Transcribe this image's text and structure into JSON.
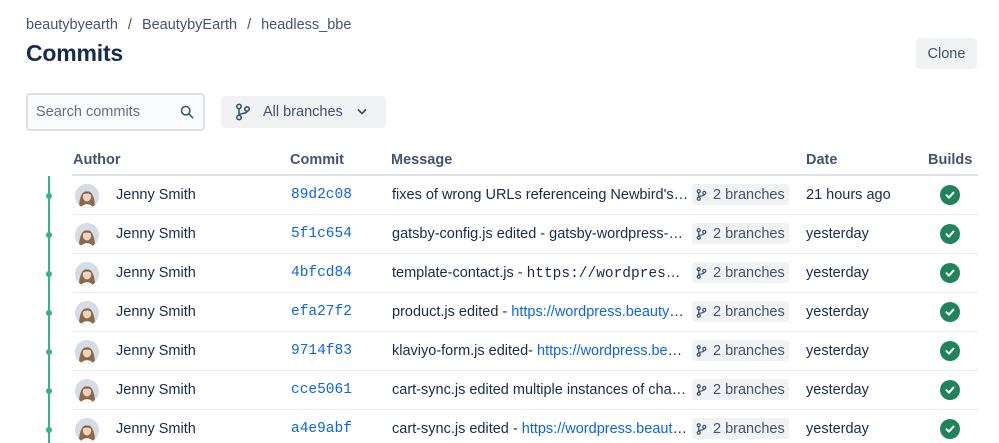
{
  "breadcrumb": {
    "workspace": "beautybyearth",
    "project": "BeautybyEarth",
    "repo": "headless_bbe",
    "separator": "/"
  },
  "page": {
    "title": "Commits",
    "clone_label": "Clone"
  },
  "search": {
    "placeholder": "Search commits",
    "value": ""
  },
  "branch_filter": {
    "label": "All branches"
  },
  "table": {
    "headers": {
      "author": "Author",
      "commit": "Commit",
      "message": "Message",
      "date": "Date",
      "builds": "Builds"
    },
    "rows": [
      {
        "author": "Jenny Smith",
        "hash": "89d2c08",
        "msg_text": "fixes of wrong URLs referenceing Newbird's domain",
        "msg_link": "",
        "msg_code": "",
        "branches": "2 branches",
        "date": "21 hours ago",
        "build_status": "success"
      },
      {
        "author": "Jenny Smith",
        "hash": "5f1c654",
        "msg_text": "gatsby-config.js edited - gatsby-wordpress-source",
        "msg_link": "",
        "msg_code": "",
        "branches": "2 branches",
        "date": "yesterday",
        "build_status": "success"
      },
      {
        "author": "Jenny Smith",
        "hash": "4bfcd84",
        "msg_text": "template-contact.js - ",
        "msg_link": "",
        "msg_code": "https://wordpress.beautybyearth.com",
        "branches": "2 branches",
        "date": "yesterday",
        "build_status": "success"
      },
      {
        "author": "Jenny Smith",
        "hash": "efa27f2",
        "msg_text": "product.js edited - ",
        "msg_link": "https://wordpress.beautybyearth.com",
        "msg_code": "",
        "branches": "2 branches",
        "date": "yesterday",
        "build_status": "success"
      },
      {
        "author": "Jenny Smith",
        "hash": "9714f83",
        "msg_text": "klaviyo-form.js edited- ",
        "msg_link": "https://wordpress.beautybyearth.com",
        "msg_code": "",
        "branches": "2 branches",
        "date": "yesterday",
        "build_status": "success"
      },
      {
        "author": "Jenny Smith",
        "hash": "cce5061",
        "msg_text": "cart-sync.js edited multiple instances of changes",
        "msg_link": "",
        "msg_code": "",
        "branches": "2 branches",
        "date": "yesterday",
        "build_status": "success"
      },
      {
        "author": "Jenny Smith",
        "hash": "a4e9abf",
        "msg_text": "cart-sync.js edited - ",
        "msg_link": "https://wordpress.beautybyearth.com",
        "msg_code": "",
        "branches": "2 branches",
        "date": "yesterday",
        "build_status": "success"
      }
    ]
  },
  "colors": {
    "link": "#0c66e4",
    "timeline": "#36b37e",
    "build_success": "#1f845a"
  },
  "icons": {
    "search": "search-icon",
    "branch": "branch-icon",
    "chevron": "chevron-down-icon",
    "check": "check-circle-icon"
  }
}
